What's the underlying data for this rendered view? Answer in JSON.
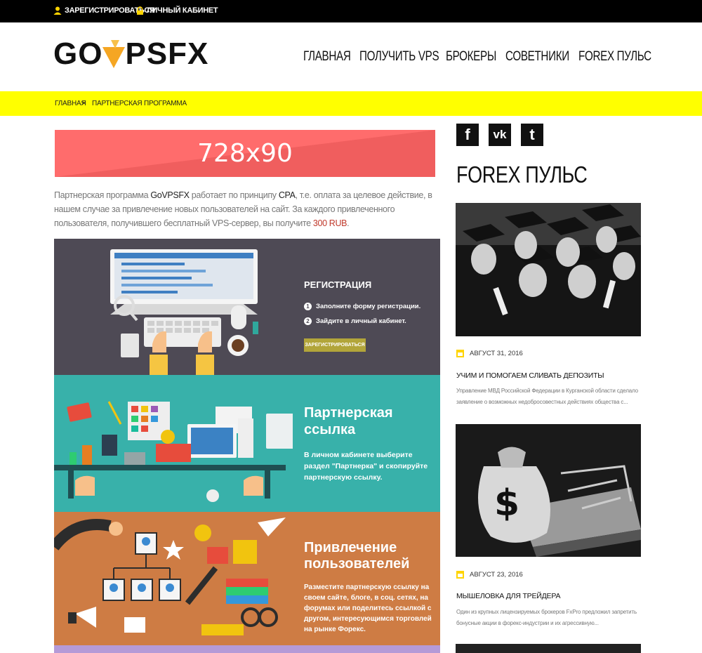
{
  "topbar": {
    "register": "Зарегистрироваться",
    "cabinet": "Личный кабинет"
  },
  "logo": {
    "left": "GO",
    "right": "PSFX"
  },
  "nav": [
    {
      "label": "Главная"
    },
    {
      "label": "Получить VPS"
    },
    {
      "label": "Брокеры"
    },
    {
      "label": "Советники"
    },
    {
      "label": "Forex пульс"
    }
  ],
  "breadcrumb": {
    "home": "Главная",
    "sep": ">",
    "current": "Партнерская программа"
  },
  "banner": {
    "text": "728x90"
  },
  "intro": {
    "p1": "Партнерская программа ",
    "brand": "GoVPSFX",
    "p2": " работает по принципу ",
    "cpa": "CPA",
    "p3": ", т.е. оплата за целевое действие, в нашем случае за привлечение новых пользователей на сайт. За каждого привлеченного пользователя, получившего бесплатный VPS-сервер, вы получите ",
    "amount": "300 RUB",
    "p4": "."
  },
  "panels": {
    "registration": {
      "title": "РЕГИСТРАЦИЯ",
      "step1_num": "1",
      "step1": "Заполните форму регистрации.",
      "step2_num": "2",
      "step2": "Зайдите в личный кабинет.",
      "button": "ЗАРЕГИСТРИРОВАТЬСЯ"
    },
    "link": {
      "title": "Партнерская ссылка",
      "text": "В личном кабинете выберите раздел \"Партнерка\" и скопируйте партнерскую ссылку."
    },
    "attract": {
      "title": "Привлечение пользователей",
      "text": "Разместите партнерскую ссылку на своем сайте, блоге, в соц. сетях, на форумах или поделитесь ссылкой с другом, интересующимся торговлей на рынке Форекс."
    }
  },
  "social": {
    "facebook": "f",
    "vk": "vk",
    "twitter": "t"
  },
  "sidebar": {
    "heading": "FOREX ПУЛЬС",
    "posts": [
      {
        "date": "Август 31, 2016",
        "title": "Учим и помогаем сливать депозиты",
        "excerpt": "Управление МВД Российской Федерации в Курганской области сделало заявление о возможных недобросовестных действиях общества с..."
      },
      {
        "date": "Август 23, 2016",
        "title": "Мышеловка для трейдера",
        "excerpt": "Один из крупных лицензируемых брокеров FxPro предложил запретить бонусные акции в форекс-индустрии и их агрессивную..."
      }
    ]
  },
  "colors": {
    "accent_yellow": "#ffff00",
    "logo_orange": "#f5a623",
    "banner": "#ff6c6c",
    "panel_dark": "#4e4a55",
    "panel_teal": "#38b1aa",
    "panel_orange": "#ce7c44",
    "panel_purple": "#b59ad7"
  }
}
